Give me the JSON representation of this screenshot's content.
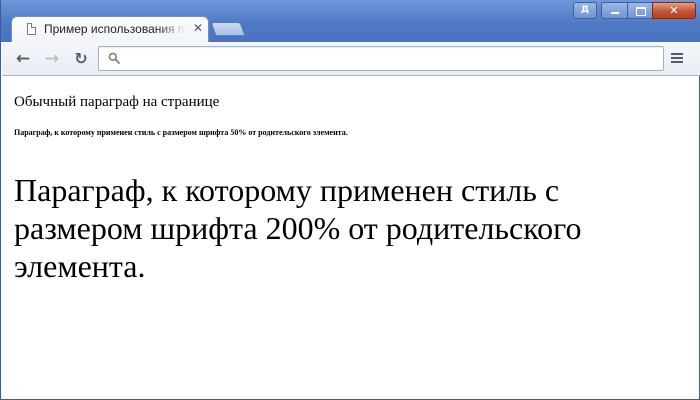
{
  "browser": {
    "tab": {
      "title": "Пример использования про"
    },
    "user_badge": "Д",
    "address_bar": {
      "value": "",
      "placeholder": ""
    }
  },
  "page": {
    "paragraph_normal": "Обычный параграф на странице",
    "paragraph_small": "Параграф, к которому применен стиль с размером шрифта 50% от родительского элемента.",
    "paragraph_large": "Параграф, к которому применен стиль с размером шрифта 200% от родительского элемента."
  },
  "icons": {
    "tab": "page-icon",
    "close": "close-icon",
    "back": "arrow-left-icon",
    "forward": "arrow-right-icon",
    "reload": "reload-icon",
    "search": "search-icon",
    "menu": "menu-icon"
  },
  "colors": {
    "titlebar": "#4f79c6",
    "toolbar": "#eef1f6",
    "close_button": "#c2553a"
  }
}
